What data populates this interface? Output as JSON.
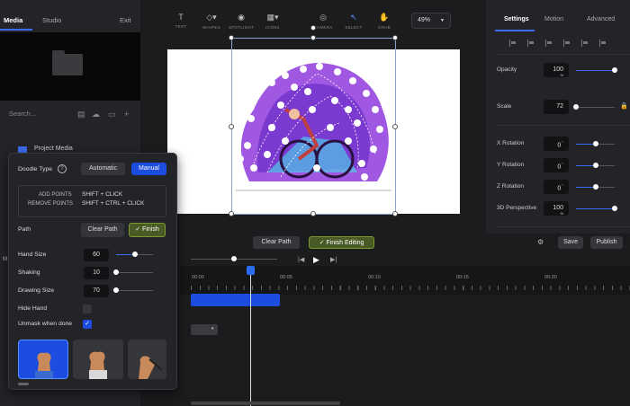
{
  "left": {
    "tabs": [
      "Media",
      "Studio",
      "Exit"
    ],
    "search_placeholder": "Search...",
    "project_media": "Project Media"
  },
  "toolbar": {
    "tools": [
      {
        "icon": "text-icon",
        "glyph": "T",
        "label": "TEXT"
      },
      {
        "icon": "shapes-icon",
        "glyph": "◇▾",
        "label": "SHAPES"
      },
      {
        "icon": "spotlight-icon",
        "glyph": "◉",
        "label": "SPOTLIGHT"
      },
      {
        "icon": "icons-icon",
        "glyph": "▦▾",
        "label": "ICONS"
      },
      {
        "icon": "camera-icon",
        "glyph": "◎",
        "label": "CAMERA"
      },
      {
        "icon": "select-icon",
        "glyph": "↖",
        "label": "SELECT"
      },
      {
        "icon": "grab-icon",
        "glyph": "✋",
        "label": "GRAB"
      }
    ],
    "zoom": "49%"
  },
  "right": {
    "tabs": [
      "Settings",
      "Motion",
      "Advanced"
    ],
    "properties": [
      {
        "label": "Opacity",
        "value": "100",
        "unit": "%",
        "fraction": 1.0
      },
      {
        "label": "Scale",
        "value": "72",
        "unit": "",
        "fraction": 0.0
      },
      {
        "label": "X Rotation",
        "value": "0",
        "unit": "°",
        "fraction": 0.5
      },
      {
        "label": "Y Rotation",
        "value": "0",
        "unit": "°",
        "fraction": 0.5
      },
      {
        "label": "Z Rotation",
        "value": "0",
        "unit": "°",
        "fraction": 0.5
      },
      {
        "label": "3D Perspective",
        "value": "100",
        "unit": "%",
        "fraction": 1.0
      }
    ]
  },
  "actions": {
    "clear_path": "Clear Path",
    "finish_editing": "✓ Finish Editing",
    "save": "Save",
    "publish": "Publish"
  },
  "timeline": {
    "ticks": [
      "00:00",
      "00:05",
      "00:10",
      "00:15",
      "00:20"
    ],
    "zoom_fraction": 0.5
  },
  "doodle": {
    "type_label": "Doodle Type",
    "automatic": "Automatic",
    "manual": "Manual",
    "add_points_label": "ADD POINTS",
    "add_points_keys": "SHIFT + CLICK",
    "remove_points_label": "REMOVE POINTS",
    "remove_points_keys": "SHIFT + CTRL + CLICK",
    "path_label": "Path",
    "clear_path": "Clear Path",
    "finish": "✓ Finish",
    "hand_size_label": "Hand Size",
    "hand_size": "60",
    "hand_size_fraction": 0.5,
    "shaking_label": "Shaking",
    "shaking": "10",
    "shaking_fraction": 0.0,
    "drawing_size_label": "Drawing Size",
    "drawing_size": "70",
    "drawing_size_fraction": 0.0,
    "hide_hand_label": "Hide Hand",
    "unmask_label": "Unmask when done"
  },
  "colors": {
    "accent": "#1c4ce0",
    "green": "#7a9a30",
    "purple": "#9b4fe0"
  }
}
